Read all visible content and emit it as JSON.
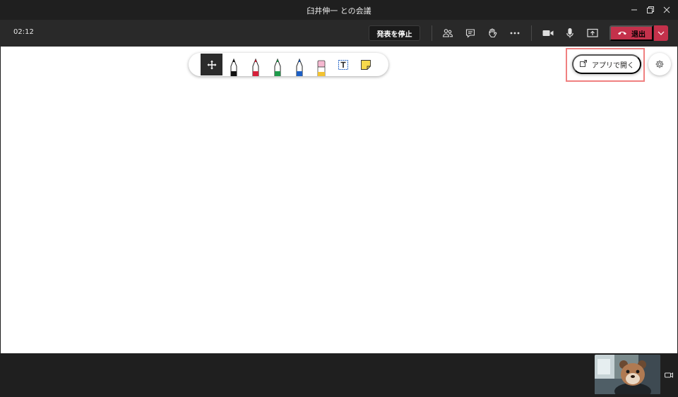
{
  "window": {
    "title": "臼井伸一 との会議"
  },
  "meeting": {
    "timer": "02:12",
    "stop_presenting_label": "発表を停止",
    "leave_label": "退出"
  },
  "whiteboard": {
    "tools": [
      {
        "name": "select-move",
        "selected": true
      },
      {
        "name": "pen-black",
        "color": "#111111"
      },
      {
        "name": "pen-red",
        "color": "#d6203a"
      },
      {
        "name": "pen-green",
        "color": "#1e9a4a"
      },
      {
        "name": "pen-blue",
        "color": "#1d5fc4"
      },
      {
        "name": "eraser",
        "color": "#f5b8d0"
      },
      {
        "name": "text-box"
      },
      {
        "name": "sticky-note",
        "color": "#f7d94c"
      }
    ],
    "open_in_app_label": "アプリで開く"
  },
  "colors": {
    "titlebar": "#1f1f1f",
    "toolbar": "#292929",
    "leave_red": "#c4314b",
    "highlight": "#f08080"
  }
}
